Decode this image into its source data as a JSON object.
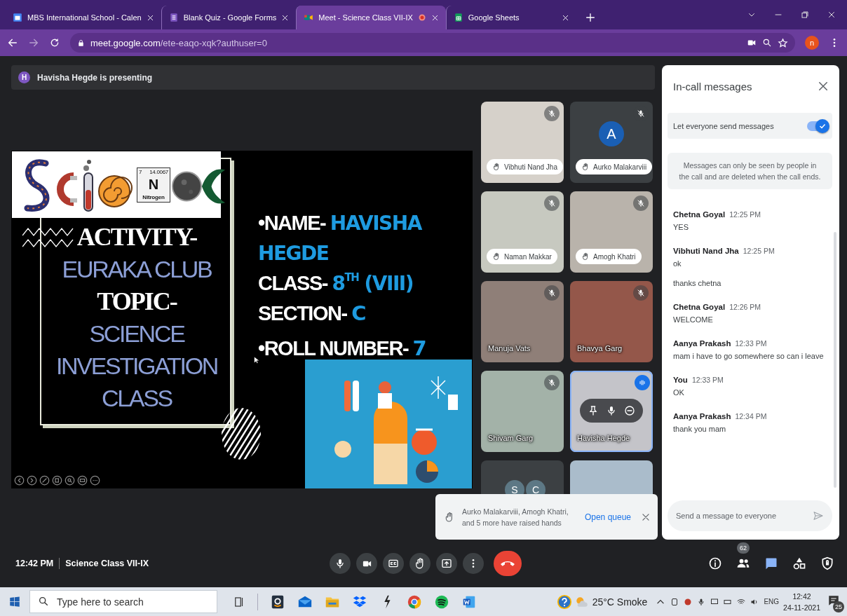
{
  "browser": {
    "tabs": [
      {
        "kind": "calendar",
        "title": "MBS International School - Calen",
        "selected": false,
        "recording": false
      },
      {
        "kind": "forms",
        "title": "Blank Quiz - Google Forms",
        "selected": false,
        "recording": false
      },
      {
        "kind": "meet",
        "title": "Meet - Science Class VII-IX",
        "selected": true,
        "recording": true
      },
      {
        "kind": "sheets",
        "title": "Google Sheets",
        "selected": false,
        "recording": false
      }
    ],
    "url": {
      "host": "meet.google.com",
      "path": "/ete-eaqo-xqk?authuser=0"
    },
    "profile_initial": "n"
  },
  "presenting": {
    "avatar": "H",
    "text": "Havisha Hegde is presenting"
  },
  "slide": {
    "element_tile": {
      "number": "7",
      "mass": "14.0067",
      "symbol": "N",
      "name": "Nitrogen"
    },
    "title_lines": [
      {
        "kind": "heading",
        "text": "ACTIVITY-"
      },
      {
        "kind": "subtitle",
        "text": "EURAKA CLUB"
      },
      {
        "kind": "heading",
        "text": "TOPIC-"
      },
      {
        "kind": "subtitle",
        "text": "SCIENCE INVESTIGATION CLASS"
      }
    ],
    "details": [
      {
        "label": "•NAME-",
        "value": "HAVISHA HEGDE",
        "kind": "heavy"
      },
      {
        "label": "CLASS-",
        "value": "8$^{TH}$ (VIII)",
        "kind": "heavy"
      },
      {
        "label": "SECTION-",
        "value": "C",
        "kind": "plain"
      },
      {
        "label": "•ROLL NUMBER-",
        "value": "7",
        "kind": "plain"
      }
    ]
  },
  "tiles": [
    {
      "kind": "video",
      "name": "Vibhuti Nand Jha",
      "muted": true,
      "hand_raised": true,
      "speaking": false,
      "hovered": false
    },
    {
      "kind": "avatar",
      "initial": "A",
      "name": "Aurko Malakarviii",
      "muted": true,
      "hand_raised": true,
      "speaking": false,
      "hovered": false
    },
    {
      "kind": "video",
      "name": "Naman Makkar",
      "muted": true,
      "hand_raised": true,
      "speaking": false,
      "hovered": false
    },
    {
      "kind": "video",
      "name": "Amogh Khatri",
      "muted": true,
      "hand_raised": true,
      "speaking": false,
      "hovered": false
    },
    {
      "kind": "video",
      "name": "Manuja Vats",
      "muted": true,
      "hand_raised": false,
      "speaking": false,
      "hovered": false
    },
    {
      "kind": "video",
      "name": "Bhavya Garg",
      "muted": true,
      "hand_raised": false,
      "speaking": false,
      "hovered": false
    },
    {
      "kind": "video",
      "name": "Shivam Garg",
      "muted": true,
      "hand_raised": false,
      "speaking": false,
      "hovered": false
    },
    {
      "kind": "video",
      "name": "Havisha Hegde",
      "muted": false,
      "hand_raised": false,
      "speaking": true,
      "hovered": true
    },
    {
      "kind": "avatars",
      "initials": [
        "S",
        "C"
      ],
      "muted": false,
      "hand_raised": false,
      "speaking": false,
      "hovered": false
    },
    {
      "kind": "video",
      "muted": false,
      "hand_raised": false,
      "speaking": false,
      "hovered": false
    }
  ],
  "notification": {
    "text": "Aurko Malakarviii, Amogh Khatri, and 5 more have raised hands",
    "action": "Open queue"
  },
  "chat": {
    "title": "In-call messages",
    "toggle": {
      "label": "Let everyone send messages",
      "on": true
    },
    "note": "Messages can only be seen by people in the call and are deleted when the call ends.",
    "messages": [
      {
        "sender": "Chetna Goyal",
        "time": "12:25 PM",
        "lines": [
          "YES"
        ]
      },
      {
        "sender": "Vibhuti Nand Jha",
        "time": "12:25 PM",
        "lines": [
          "ok",
          "thanks chetna"
        ]
      },
      {
        "sender": "Chetna Goyal",
        "time": "12:26 PM",
        "lines": [
          "WELCOME"
        ]
      },
      {
        "sender": "Aanya Prakash",
        "time": "12:33 PM",
        "lines": [
          "mam i have to go somewhere so can i leave"
        ]
      },
      {
        "sender": "You",
        "time": "12:33 PM",
        "lines": [
          "OK"
        ]
      },
      {
        "sender": "Aanya Prakash",
        "time": "12:34 PM",
        "lines": [
          "thank you mam"
        ]
      }
    ],
    "input_placeholder": "Send a message to everyone"
  },
  "call_bar": {
    "time": "12:42 PM",
    "meeting": "Science Class VII-IX",
    "people_count": "62"
  },
  "taskbar": {
    "search_placeholder": "Type here to search",
    "weather": "25°C Smoke",
    "language": "ENG",
    "time": "12:42",
    "date": "24-11-2021",
    "notifications": "25"
  }
}
